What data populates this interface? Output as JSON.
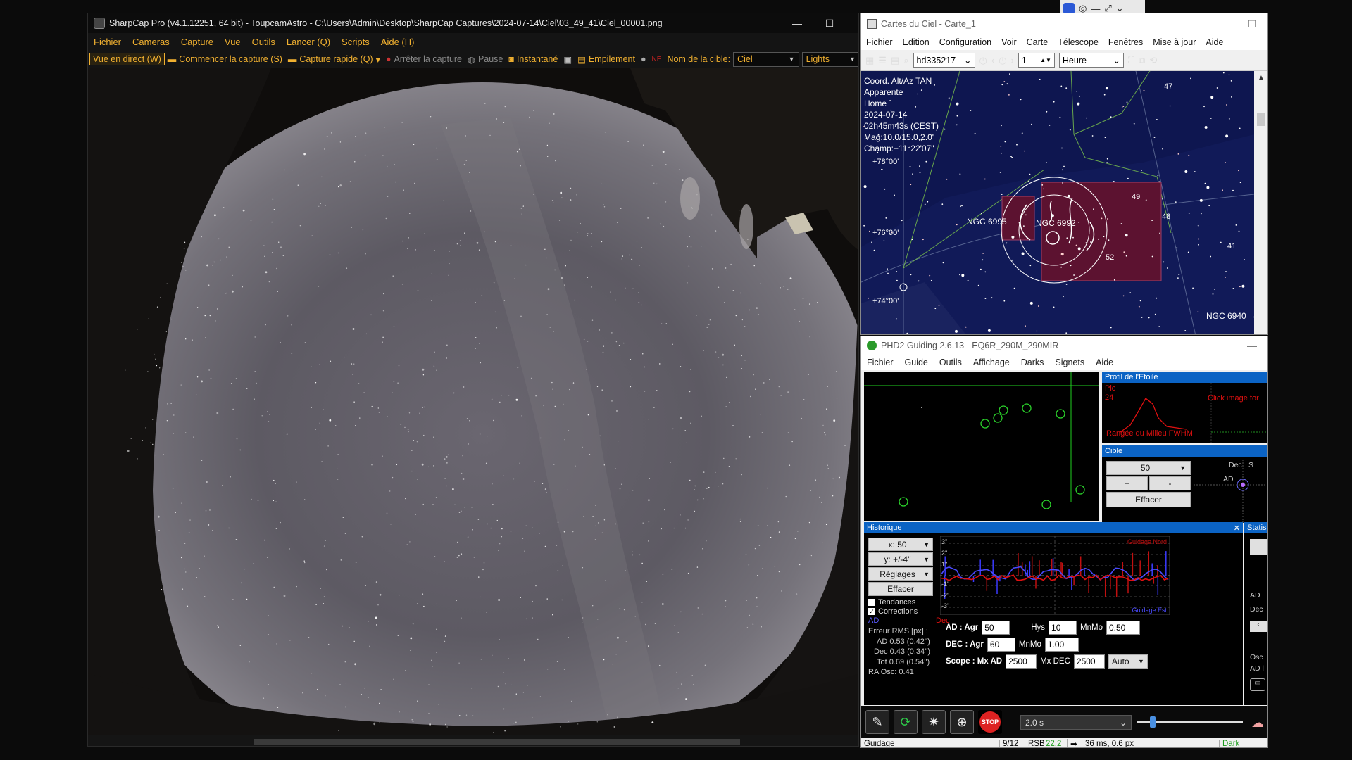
{
  "sharpcap": {
    "title": "SharpCap Pro (v4.1.12251, 64 bit) - ToupcamAstro - C:\\Users\\Admin\\Desktop\\SharpCap Captures\\2024-07-14\\Ciel\\03_49_41\\Ciel_00001.png",
    "menu": [
      "Fichier",
      "Cameras",
      "Capture",
      "Vue",
      "Outils",
      "Lancer (Q)",
      "Scripts",
      "Aide (H)"
    ],
    "toolbar": {
      "live_view": "Vue en direct (W)",
      "start_capture": "Commencer la capture (S)",
      "quick_capture": "Capture rapide (Q)",
      "stop_capture": "Arrêter la capture",
      "pause": "Pause",
      "snapshot": "Instantané",
      "stacking": "Empilement",
      "target_label": "Nom de la cible:",
      "target_value": "Ciel",
      "frame_type": "Lights"
    }
  },
  "cdc": {
    "title": "Cartes du Ciel - Carte_1",
    "menu": [
      "Fichier",
      "Edition",
      "Configuration",
      "Voir",
      "Carte",
      "Télescope",
      "Fenêtres",
      "Mise à jour",
      "Aide"
    ],
    "search_value": "hd335217",
    "step_value": "1",
    "unit_value": "Heure",
    "info": [
      "Coord. Alt/Az TAN",
      "Apparente",
      "Home",
      "2024-07-14",
      "02h45m43s (CEST)",
      "Mag:10.0/15.0,2.0'",
      "Champ:+11°22'07\""
    ],
    "labels": {
      "ngc6995": "NGC 6995",
      "ngc6992": "NGC 6992",
      "ngc6940": "NGC 6940",
      "dec78": "+78°00'",
      "dec76": "+76°00'",
      "dec74": "+74°00'",
      "n47": "47",
      "n49": "49",
      "n48": "48",
      "n52": "52",
      "n41": "41"
    }
  },
  "phd": {
    "title": "PHD2 Guiding 2.6.13 - EQ6R_290M_290MIR",
    "menu": [
      "Fichier",
      "Guide",
      "Outils",
      "Affichage",
      "Darks",
      "Signets",
      "Aide"
    ],
    "profile": {
      "title": "Profil de l'Etoile",
      "peak": "Pic",
      "peak_val": "24",
      "mid": "Rangée du Milieu FWHM",
      "click": "Click image for"
    },
    "target": {
      "title": "Cible",
      "value": "50",
      "plus": "+",
      "minus": "-",
      "clear": "Effacer",
      "dec": "Dec",
      "ra": "AD",
      "s": "S"
    },
    "history": {
      "title": "Historique",
      "x": "x:  50",
      "y": "y: +/-4''",
      "settings": "Réglages",
      "clear": "Effacer",
      "trends": "Tendances",
      "corrections": "Corrections",
      "ad": "AD",
      "dec": "Dec",
      "rms_title": "Erreur RMS [px] :",
      "rms_ad": "AD  0.53 (0.42'')",
      "rms_dec": "Dec  0.43 (0.34'')",
      "rms_tot": "Tot  0.69 (0.54'')",
      "ra_osc": "RA Osc: 0.41",
      "north": "Guidage Nord",
      "east": "Guidage Est",
      "y3": "3''",
      "y2": "2''",
      "y1": "1''",
      "ym1": "-1''",
      "ym2": "-2''",
      "ym3": "-3''"
    },
    "params": {
      "ad": "AD : Agr",
      "ad_agr": "50",
      "hys": "Hys",
      "hys_val": "10",
      "mnmo": "MnMo",
      "ad_mnmo": "0.50",
      "dec": "DEC : Agr",
      "dec_agr": "60",
      "dec_mnmo_label": "MnMo",
      "dec_mnmo": "1.00",
      "scope": "Scope : Mx AD",
      "mx_ad": "2500",
      "mx_dec_label": "Mx DEC",
      "mx_dec": "2500",
      "mode": "Auto"
    },
    "stats": {
      "title": "Statist",
      "ad": "AD",
      "dec": "Dec",
      "osc": "Osc",
      "adl": "AD l"
    },
    "exposure": "2.0 s",
    "stop": "STOP",
    "status": {
      "mode": "Guidage",
      "frames": "9/12",
      "snr_label": "RSB",
      "snr": "22.2",
      "guide": "36 ms, 0.6 px",
      "dark": "Dark"
    }
  },
  "colors": {
    "sharpcap_accent": "#f0b030",
    "phd_blue": "#0b63c4",
    "ra_trace": "#4a4aff",
    "dec_trace": "#e01010"
  }
}
